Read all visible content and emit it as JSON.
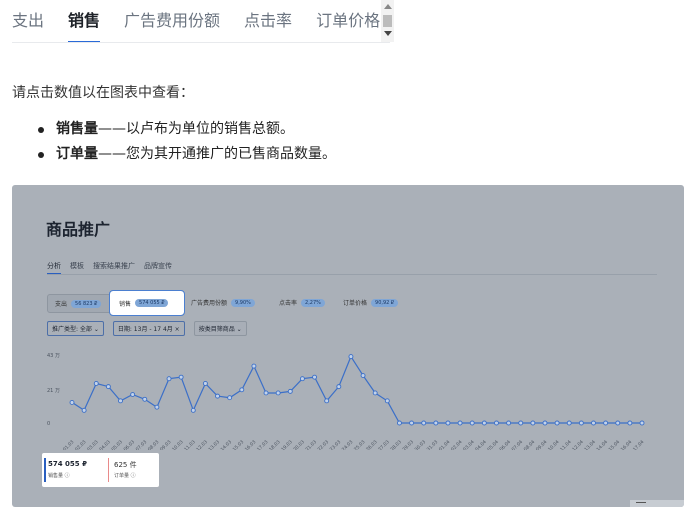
{
  "tabs": [
    "支出",
    "销售",
    "广告费用份额",
    "点击率",
    "订单价格"
  ],
  "active_tab": "销售",
  "intro": "请点击数值以在图表中查看：",
  "bullets": [
    {
      "term": "销售量",
      "text": "——以卢布为单位的销售总额。"
    },
    {
      "term": "订单量",
      "text": "——您为其开通推广的已售商品数量。"
    }
  ],
  "screenshot": {
    "title": "商品推广",
    "subtabs": [
      "分析",
      "模板",
      "搜索结果推广",
      "品牌宣传"
    ],
    "metrics": [
      {
        "label": "支出",
        "value": "56 823 ₽"
      },
      {
        "label": "销售",
        "value": "574 055 ₽"
      },
      {
        "label": "广告费用份额",
        "value": "9,90%"
      },
      {
        "label": "点击率",
        "value": "2,27%"
      },
      {
        "label": "订单价格",
        "value": "90,92 ₽"
      }
    ],
    "filters": [
      "推广类型: 全部 ⌄",
      "日期: 13月 - 17 4月 ×",
      "按类目筛商品 ⌄"
    ],
    "summary": {
      "sales_value": "574 055 ₽",
      "sales_label": "销售量 ⓘ",
      "orders_value": "625 件",
      "orders_label": "订单量 ⓘ"
    }
  },
  "chart_data": {
    "type": "line",
    "y_ticks": [
      "43 万",
      "21 万",
      "0"
    ],
    "ylim": [
      0,
      43
    ],
    "x": [
      "01.03",
      "02.03",
      "03.03",
      "04.03",
      "05.03",
      "06.03",
      "07.03",
      "08.03",
      "09.03",
      "10.03",
      "11.03",
      "12.03",
      "13.03",
      "14.03",
      "15.03",
      "16.03",
      "17.03",
      "18.03",
      "19.03",
      "20.03",
      "21.03",
      "22.03",
      "23.03",
      "24.03",
      "25.03",
      "26.03",
      "27.03",
      "28.03",
      "29.03",
      "30.03",
      "31.03",
      "01.04",
      "02.04",
      "03.04",
      "04.04",
      "05.04",
      "06.04",
      "07.04",
      "08.04",
      "09.04",
      "10.04",
      "11.04",
      "12.04",
      "13.04",
      "14.04",
      "15.04",
      "16.04",
      "17.04"
    ],
    "values": [
      13,
      8,
      25,
      23,
      14,
      18,
      15,
      10,
      28,
      29,
      8,
      25,
      17,
      16,
      21,
      36,
      19,
      19,
      20,
      28,
      29,
      14,
      23,
      42,
      30,
      19,
      14,
      0,
      0,
      0,
      0,
      0,
      0,
      0,
      0,
      0,
      0,
      0,
      0,
      0,
      0,
      0,
      0,
      0,
      0,
      0,
      0,
      0
    ],
    "color": "#3b6fc8"
  }
}
